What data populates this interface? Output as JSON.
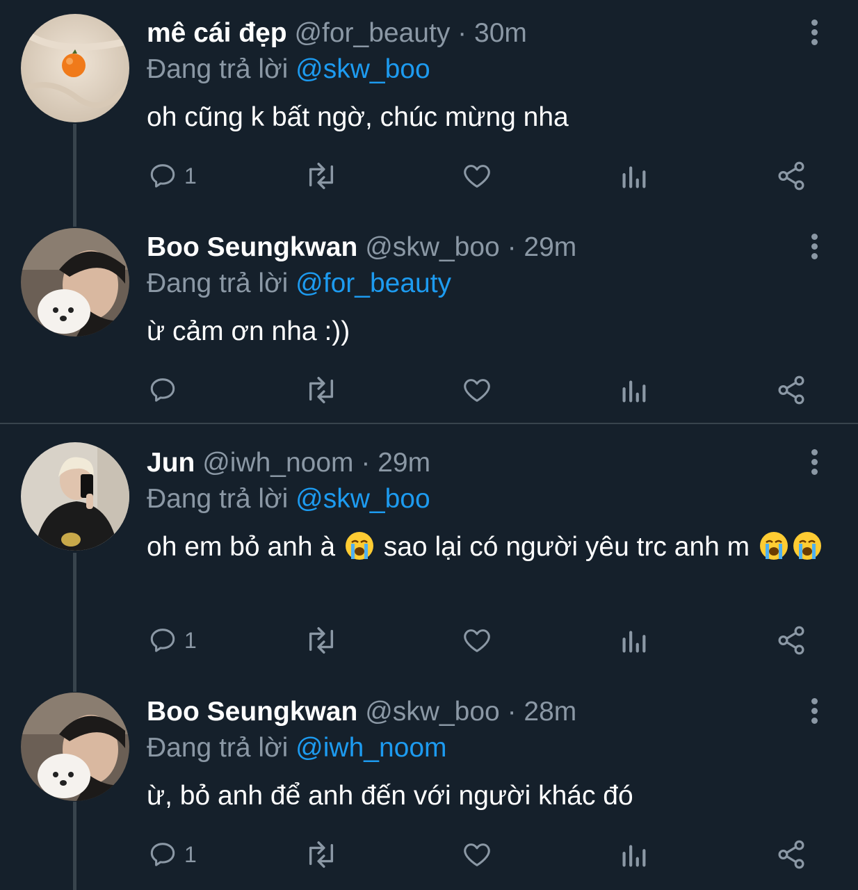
{
  "tweets": [
    {
      "name": "mê cái đẹp",
      "handle": "@for_beauty",
      "time": "30m",
      "reply_prefix": "Đang trả lời",
      "reply_to": "@skw_boo",
      "text": "oh cũng k bất ngờ, chúc mừng nha",
      "reply_count": "1"
    },
    {
      "name": "Boo Seungkwan",
      "handle": "@skw_boo",
      "time": "29m",
      "reply_prefix": "Đang trả lời",
      "reply_to": "@for_beauty",
      "text": "ừ cảm ơn nha :))",
      "reply_count": ""
    },
    {
      "name": "Jun",
      "handle": "@iwh_noom",
      "time": "29m",
      "reply_prefix": "Đang trả lời",
      "reply_to": "@skw_boo",
      "text_a": "oh em bỏ anh à",
      "text_b": "sao lại có người yêu trc anh m",
      "reply_count": "1"
    },
    {
      "name": "Boo Seungkwan",
      "handle": "@skw_boo",
      "time": "28m",
      "reply_prefix": "Đang trả lời",
      "reply_to": "@iwh_noom",
      "text": "ừ, bỏ anh để anh đến với người khác đó",
      "reply_count": "1"
    }
  ],
  "separator": "·",
  "icons": {
    "reply": "reply-icon",
    "retweet": "retweet-icon",
    "like": "heart-icon",
    "views": "analytics-icon",
    "share": "share-icon",
    "more": "more-vertical-icon",
    "emoji": "loudly-crying-face-emoji"
  },
  "colors": {
    "background": "#15202b",
    "muted": "#8b98a5",
    "mention": "#1d9bf0",
    "border": "#38444d"
  }
}
